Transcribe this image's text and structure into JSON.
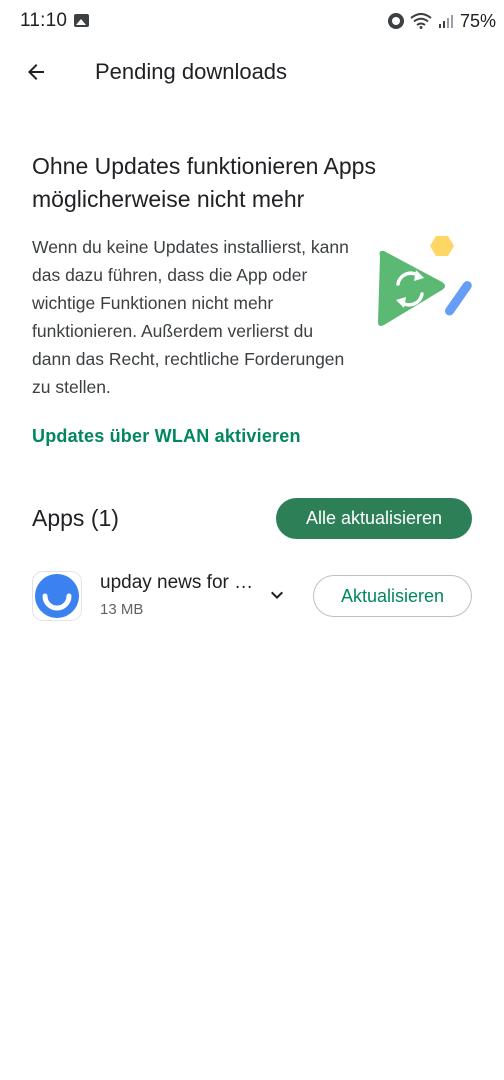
{
  "status_bar": {
    "time": "11:10",
    "battery": "75%",
    "icons": [
      "gallery-icon",
      "alarm-icon",
      "wifi-icon",
      "signal-icon"
    ]
  },
  "app_bar": {
    "title": "Pending downloads",
    "back_icon": "arrow-back-icon"
  },
  "warning": {
    "headline": "Ohne Updates funktionieren Apps möglicherweise nicht mehr",
    "body": "Wenn du keine Updates installierst, kann das dazu führen, dass die App oder wichtige Funktionen nicht mehr funktionieren. Außerdem verlierst du dann das Recht, rechtliche Forderungen zu stellen.",
    "link": "Updates über WLAN aktivieren",
    "illustration_icon": "update-illustration-icon"
  },
  "apps_section": {
    "heading": "Apps (1)",
    "update_all_label": "Alle aktualisieren",
    "items": [
      {
        "name": "upday news for Samsung",
        "size": "13 MB",
        "update_label": "Aktualisieren",
        "icon": "upday-app-icon"
      }
    ]
  },
  "colors": {
    "accent": "#01875f",
    "primary_button": "#2c7f57",
    "illustration_green": "#5bb974",
    "illustration_yellow": "#fdd663",
    "illustration_blue": "#669df6",
    "upday_blue": "#3b82f0"
  }
}
